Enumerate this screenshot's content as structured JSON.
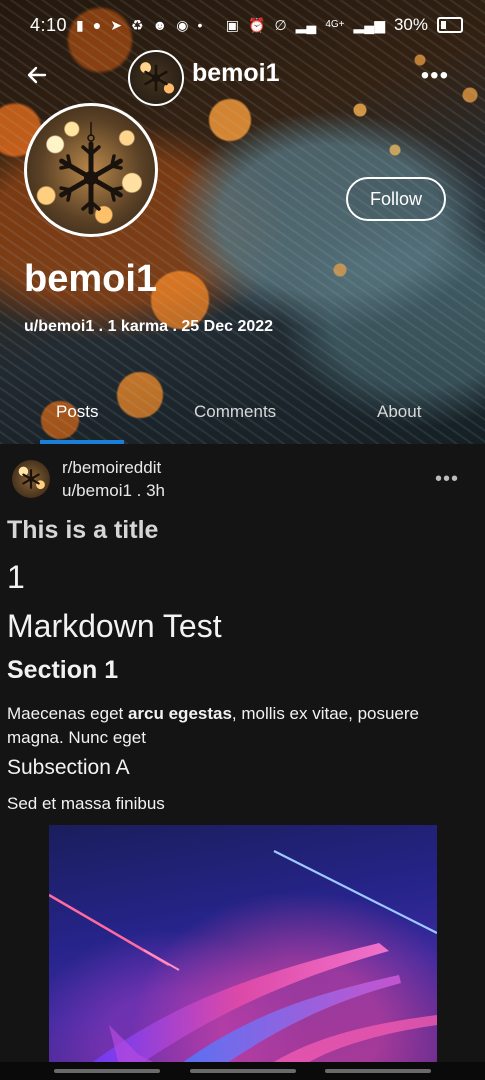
{
  "status_bar": {
    "time": "4:10",
    "network": "4G+",
    "battery": "30%"
  },
  "header": {
    "username": "bemoi1",
    "follow_label": "Follow",
    "display_name": "bemoi1",
    "meta": "u/bemoi1 . 1 karma . 25 Dec 2022"
  },
  "tabs": [
    {
      "label": "Posts",
      "active": true
    },
    {
      "label": "Comments",
      "active": false
    },
    {
      "label": "About",
      "active": false
    }
  ],
  "post": {
    "subreddit": "r/bemoireddit",
    "author_time": "u/bemoi1 . 3h",
    "title": "This is a title",
    "body": {
      "heading_num": "1",
      "h1": "Markdown Test",
      "h2": "Section 1",
      "paragraph_pre": "Maecenas eget ",
      "paragraph_bold": "arcu egestas",
      "paragraph_post": ", mollis ex vitae, posuere magna. Nunc eget",
      "h3": "Subsection A",
      "paragraph2": "Sed et massa finibus"
    }
  },
  "colors": {
    "accent": "#1a7fd8",
    "background": "#141414"
  }
}
